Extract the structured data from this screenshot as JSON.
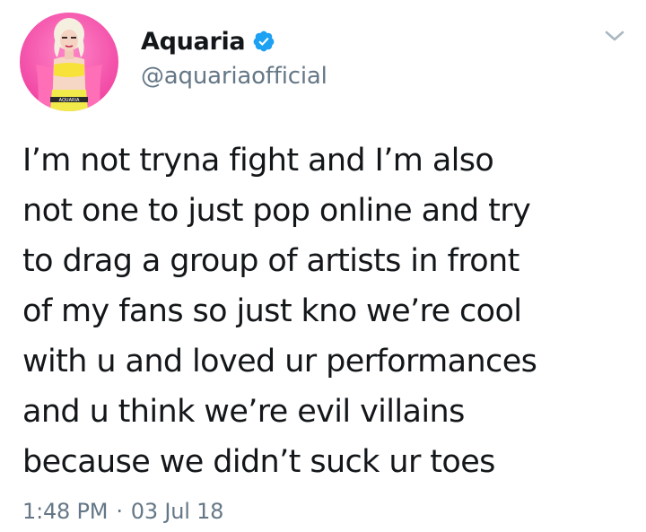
{
  "tweet": {
    "author": {
      "display_name": "Aquaria",
      "handle": "@aquariaofficial",
      "verified": true,
      "avatar_text": "AQUARIA"
    },
    "text_lines": [
      "I’m not tryna fight and I’m also",
      "not one to just pop online and try",
      "to drag a group of artists in front",
      "of my fans so just kno we’re cool",
      "with u and loved ur performances",
      "and u think we’re evil villains",
      "because we didn’t suck ur toes"
    ],
    "time": "1:48 PM",
    "separator": "·",
    "date": "03 Jul 18"
  },
  "icons": {
    "verified": "verified-badge-icon",
    "menu": "chevron-down-icon"
  },
  "colors": {
    "text": "#14171a",
    "secondary": "#657786",
    "verified_blue": "#1da1f2",
    "avatar_bg": "#f25bb0"
  }
}
